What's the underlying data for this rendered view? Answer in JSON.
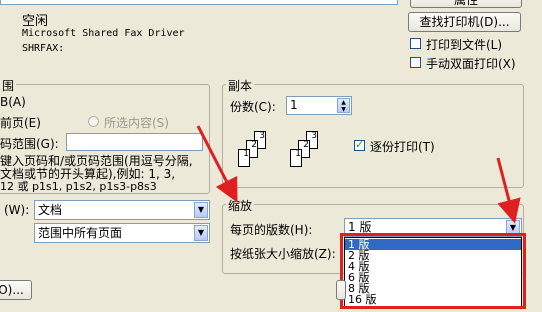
{
  "printer": {
    "top_button_label": "属性",
    "status": "空闲",
    "type": "Microsoft Shared Fax Driver",
    "where": "SHRFAX:",
    "find_printer_button": "查找打印机(D)...",
    "print_to_file": "打印到文件(L)",
    "manual_duplex": "手动双面打印(X)"
  },
  "page_range": {
    "title": "围",
    "all": "B(A)",
    "current_page": "前页(E)",
    "selection": "所选内容(S)",
    "pages_label": "码范围(G):",
    "hint_line1": "键入页码和/或页码范围(用逗号分隔,",
    "hint_line2": "文档或节的开头算起),例如: 1, 3,",
    "hint_line3": "12 或 p1s1, p1s2, p1s3-p8s3"
  },
  "print_what": {
    "label": "(W):",
    "value": "文档"
  },
  "print_range": {
    "value": "范围中所有页面"
  },
  "copies": {
    "title": "副本",
    "count_label": "份数(C):",
    "count_value": "1",
    "collate_label": "逐份打印(T)",
    "collate_checked": true,
    "page_numbers": [
      "1",
      "2",
      "3",
      "1",
      "2",
      "3"
    ]
  },
  "zoom": {
    "title": "缩放",
    "pages_per_sheet_label": "每页的版数(H):",
    "pages_per_sheet_value": "1 版",
    "scale_label": "按纸张大小缩放(Z):",
    "options": [
      "1 版",
      "2 版",
      "4 版",
      "6 版",
      "8 版",
      "16 版"
    ]
  },
  "footer": {
    "options_button": "O)..."
  },
  "colors": {
    "highlight": "#316ac5",
    "annotation_red": "#e02020"
  }
}
